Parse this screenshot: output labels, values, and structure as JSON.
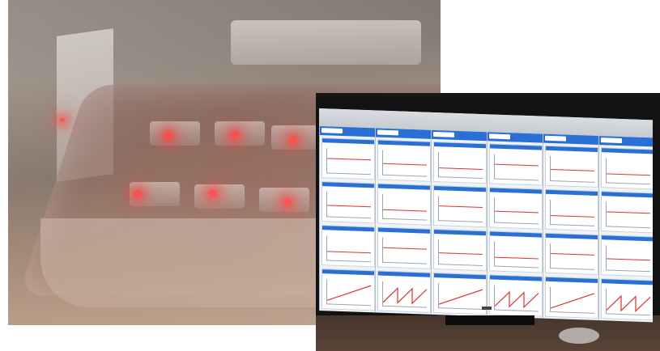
{
  "scene": {
    "left_photo": "plastic-enclosure-with-red-leds",
    "right_photo": "monitor-with-dashboard-grid"
  },
  "colors": {
    "led": "#ff3a3a",
    "dashboard_header": "#2a6fd6",
    "screen_bg": "#eef3f8"
  },
  "dashboard": {
    "columns": 6,
    "rows": 4
  }
}
